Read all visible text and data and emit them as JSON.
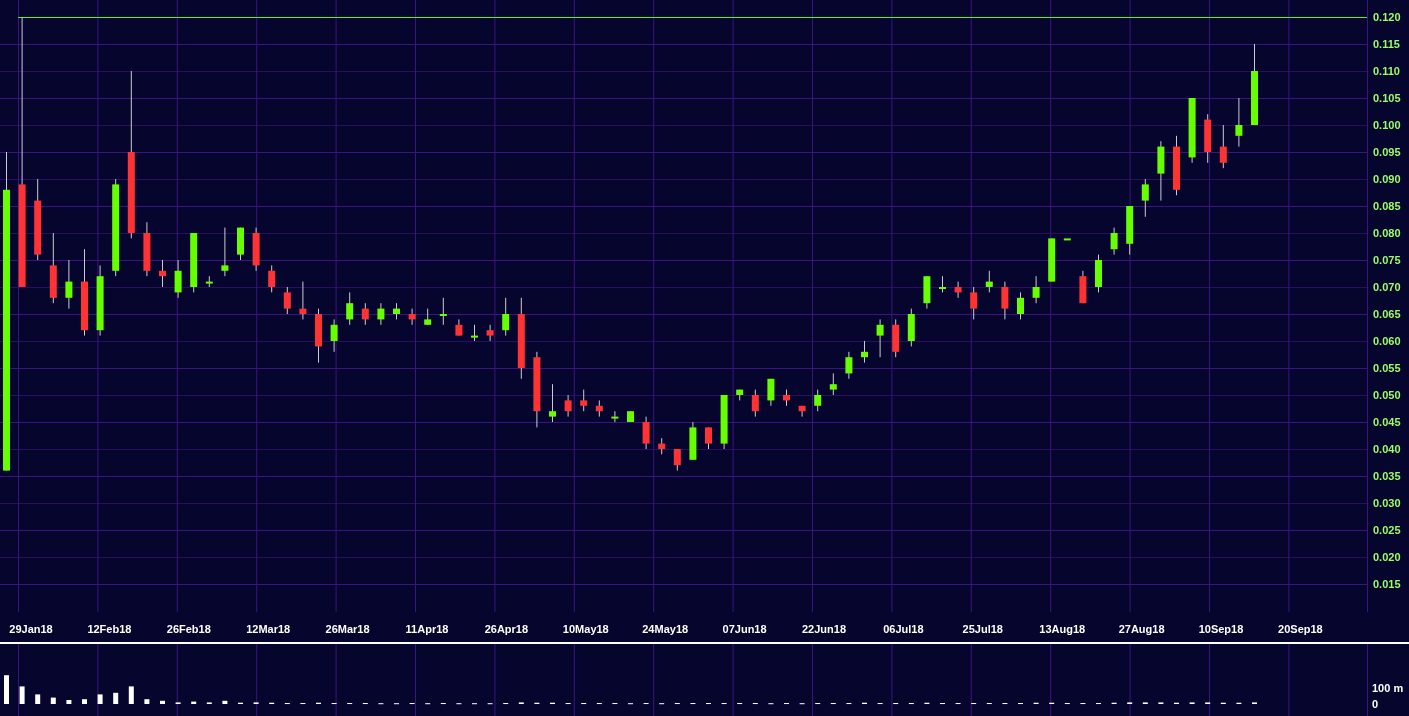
{
  "price_axis": {
    "labels": [
      "0.120",
      "0.115",
      "0.110",
      "0.105",
      "0.100",
      "0.095",
      "0.090",
      "0.085",
      "0.080",
      "0.075",
      "0.070",
      "0.065",
      "0.060",
      "0.055",
      "0.050",
      "0.045",
      "0.040",
      "0.035",
      "0.030",
      "0.025",
      "0.020",
      "0.015"
    ]
  },
  "date_axis": {
    "labels": [
      "29Jan18",
      "12Feb18",
      "26Feb18",
      "12Mar18",
      "26Mar18",
      "11Apr18",
      "26Apr18",
      "10May18",
      "24May18",
      "07Jun18",
      "22Jun18",
      "06Jul18",
      "25Jul18",
      "13Aug18",
      "27Aug18",
      "10Sep18",
      "20Sep18"
    ]
  },
  "volume_axis": {
    "labels": [
      "100 m",
      "0"
    ]
  }
}
